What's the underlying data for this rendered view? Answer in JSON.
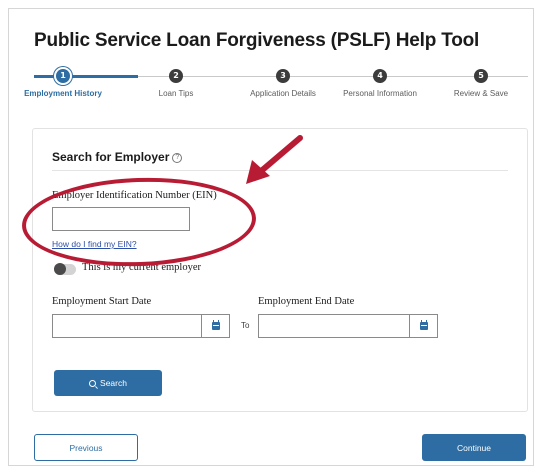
{
  "page": {
    "title": "Public Service Loan Forgiveness (PSLF) Help Tool"
  },
  "stepper": {
    "steps": [
      {
        "number": "1",
        "label": "Employment History",
        "active": true
      },
      {
        "number": "2",
        "label": "Loan Tips",
        "active": false
      },
      {
        "number": "3",
        "label": "Application Details",
        "active": false
      },
      {
        "number": "4",
        "label": "Personal Information",
        "active": false
      },
      {
        "number": "5",
        "label": "Review & Save",
        "active": false
      }
    ]
  },
  "search_employer": {
    "section_title": "Search for Employer",
    "help_icon": "?",
    "ein_label": "Employer Identification Number (EIN)",
    "ein_value": "",
    "ein_help_link": "How do I find my EIN?",
    "current_employer_toggle_label": "This is my current employer",
    "current_employer_on": false,
    "start_date_label": "Employment Start Date",
    "start_date_value": "",
    "to_label": "To",
    "end_date_label": "Employment End Date",
    "end_date_value": "",
    "search_button": "Search"
  },
  "footer": {
    "previous_button": "Previous",
    "continue_button": "Continue"
  },
  "colors": {
    "accent": "#2d6da3",
    "annotation": "#b81c34"
  },
  "icons": {
    "help": "question-circle-icon",
    "calendar": "calendar-icon",
    "search": "magnifier-icon",
    "arrow": "red-arrow-annotation",
    "ellipse": "red-ellipse-annotation"
  }
}
